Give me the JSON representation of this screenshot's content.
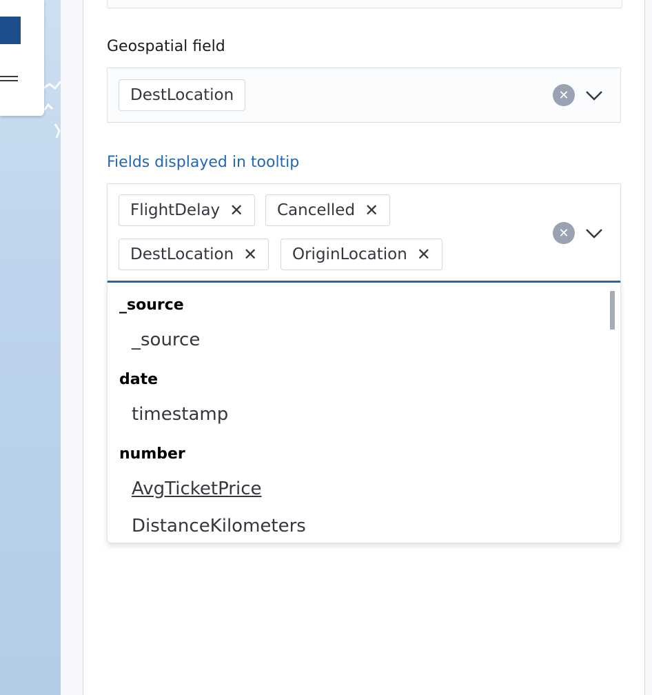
{
  "geospatial": {
    "label": "Geospatial field",
    "selected": "DestLocation"
  },
  "tooltip_fields": {
    "label": "Fields displayed in tooltip",
    "selected": [
      "FlightDelay",
      "Cancelled",
      "DestLocation",
      "OriginLocation"
    ]
  },
  "dropdown": {
    "groups": [
      {
        "name": "_source",
        "options": [
          "_source"
        ]
      },
      {
        "name": "date",
        "options": [
          "timestamp"
        ]
      },
      {
        "name": "number",
        "options": [
          "AvgTicketPrice",
          "DistanceKilometers"
        ]
      }
    ],
    "highlighted_option": "AvgTicketPrice"
  },
  "icons": {
    "clear": "clear-icon",
    "expand": "chevron-down-icon",
    "remove": "close-icon",
    "menu": "menu-icon"
  },
  "colors": {
    "accent": "#2169b3",
    "focus_border": "#2a69a8",
    "map_water": "#bed4ec",
    "map_button": "#1c4e8e"
  }
}
